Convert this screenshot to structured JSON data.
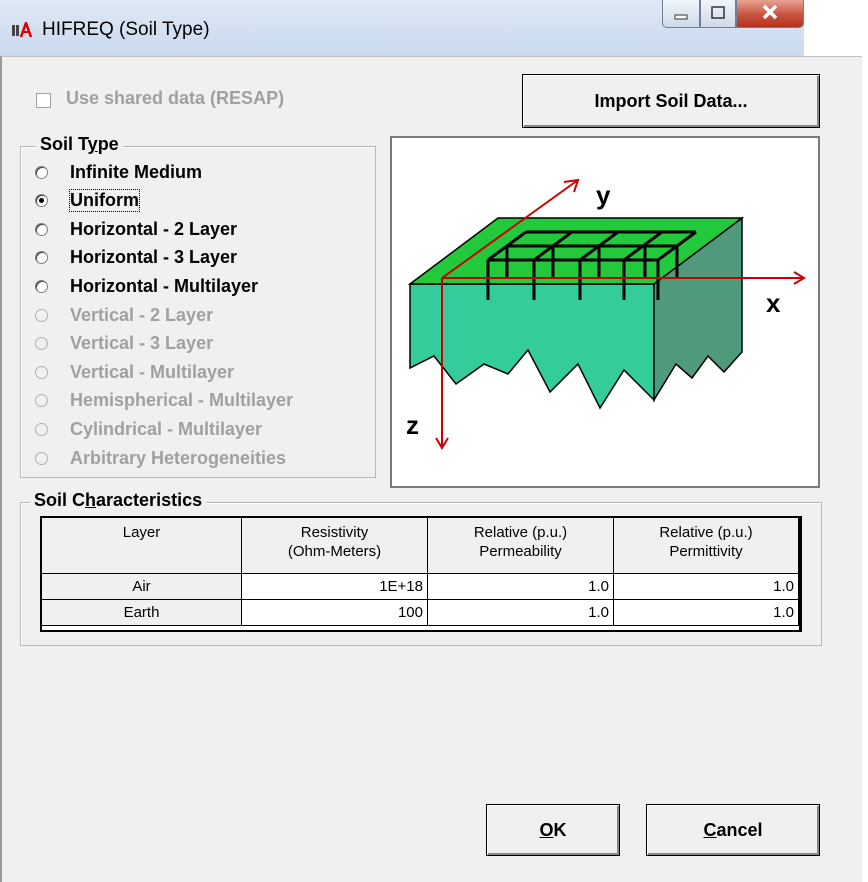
{
  "window": {
    "title": "HIFREQ (Soil Type)",
    "icon": "hifreq-app-icon",
    "controls": [
      "minimize-icon",
      "maximize-icon",
      "close-icon"
    ]
  },
  "shared_data": {
    "label": "Use shared data (RESAP)",
    "checked": false,
    "enabled": false
  },
  "import_button": {
    "label": "Import Soil Data..."
  },
  "soil_type": {
    "group_label_pre": "Soil T",
    "group_label_accel": "y",
    "group_label_post": "pe",
    "options": [
      {
        "label": "Infinite Medium",
        "checked": false,
        "enabled": true
      },
      {
        "label": "Uniform",
        "checked": true,
        "enabled": true
      },
      {
        "label": "Horizontal - 2 Layer",
        "checked": false,
        "enabled": true
      },
      {
        "label": "Horizontal - 3 Layer",
        "checked": false,
        "enabled": true
      },
      {
        "label": "Horizontal - Multilayer",
        "checked": false,
        "enabled": true
      },
      {
        "label": "Vertical - 2 Layer",
        "checked": false,
        "enabled": false
      },
      {
        "label": "Vertical - 3 Layer",
        "checked": false,
        "enabled": false
      },
      {
        "label": "Vertical - Multilayer",
        "checked": false,
        "enabled": false
      },
      {
        "label": "Hemispherical - Multilayer",
        "checked": false,
        "enabled": false
      },
      {
        "label": "Cylindrical - Multilayer",
        "checked": false,
        "enabled": false
      },
      {
        "label": "Arbitrary Heterogeneities",
        "checked": false,
        "enabled": false
      }
    ]
  },
  "diagram": {
    "axis_x": "x",
    "axis_y": "y",
    "axis_z": "z",
    "colors": {
      "soil_top": "#22c93a",
      "soil_front": "#35cc9c",
      "soil_side": "#4f9a7a",
      "axis": "#cc0000",
      "grid": "#000000"
    }
  },
  "characteristics": {
    "group_label_pre": "Soil C",
    "group_label_accel": "h",
    "group_label_post": "aracteristics",
    "headers": [
      [
        "Layer",
        ""
      ],
      [
        "Resistivity",
        "(Ohm-Meters)"
      ],
      [
        "Relative (p.u.)",
        "Permeability"
      ],
      [
        "Relative (p.u.)",
        "Permittivity"
      ]
    ],
    "rows": [
      {
        "layer": "Air",
        "resistivity": "1E+18",
        "permeability": "1.0",
        "permittivity": "1.0"
      },
      {
        "layer": "Earth",
        "resistivity": "100",
        "permeability": "1.0",
        "permittivity": "1.0"
      }
    ]
  },
  "ok_button": {
    "accel": "O",
    "rest": "K"
  },
  "cancel_button": {
    "accel": "C",
    "rest": "ancel"
  }
}
